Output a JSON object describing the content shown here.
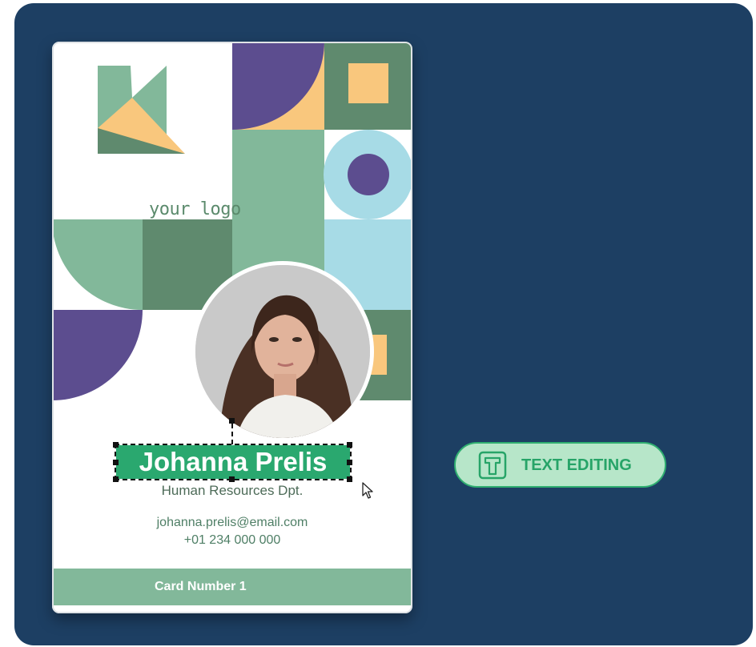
{
  "id_card": {
    "logo_text": "your logo",
    "name": "Johanna Prelis",
    "department": "Human Resources Dpt.",
    "email": "johanna.prelis@email.com",
    "phone": "+01 234 000 000",
    "card_number": "Card Number  1"
  },
  "feature_badge": {
    "label": "TEXT EDITING",
    "icon": "text-t-icon"
  },
  "colors": {
    "panel_bg": "#1d3f63",
    "purple": "#5c4d8f",
    "sage": "#82b89a",
    "dark_green": "#5f8a6e",
    "peach": "#f9c77d",
    "light_blue": "#a7dbe6",
    "accent_green": "#2aa86f"
  }
}
